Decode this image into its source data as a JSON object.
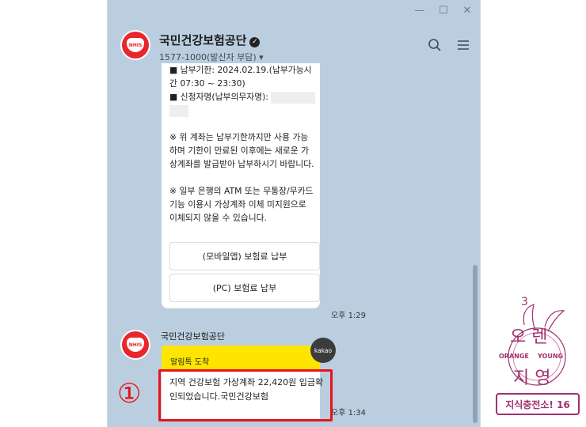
{
  "window": {
    "minimize": "—",
    "maximize": "☐",
    "close": "✕"
  },
  "header": {
    "name": "국민건강보험공단",
    "sub": "1577-1000(발신자 부담) ▾"
  },
  "logo_text": "NHIS",
  "messages": [
    {
      "text": "■ 납부기한: 2024.02.19.(납부가능시간 07:30 ~ 23:30)\n■ 신청자명(납부의무자명):",
      "notice1": "※ 위 계좌는 납부기한까지만 사용 가능하며 기한이 만료된 이후에는 새로운 가상계좌를 발급받아 납부하시기 바랍니다.",
      "notice2": "※ 일부 은행의 ATM 또는 무통장/무카드 기능 이용시 가상계좌 이체 미지원으로 이체되지 않을 수 있습니다.",
      "btn1": "(모바일앱) 보험료 납부",
      "btn2": "(PC) 보험료 납부",
      "time": "오후 1:29"
    },
    {
      "sender": "국민건강보험공단",
      "banner": "알림톡 도착",
      "badge": "kakao",
      "text": "지역  건강보험 가상계좌 22,420원 입금확인되었습니다.국민건강보험",
      "time": "오후 1:34"
    }
  ],
  "annotation": "①",
  "side": {
    "top": "오렌지영",
    "label": "지식충전소! 16",
    "en1": "ORANGE",
    "en2": "YOUNG"
  }
}
